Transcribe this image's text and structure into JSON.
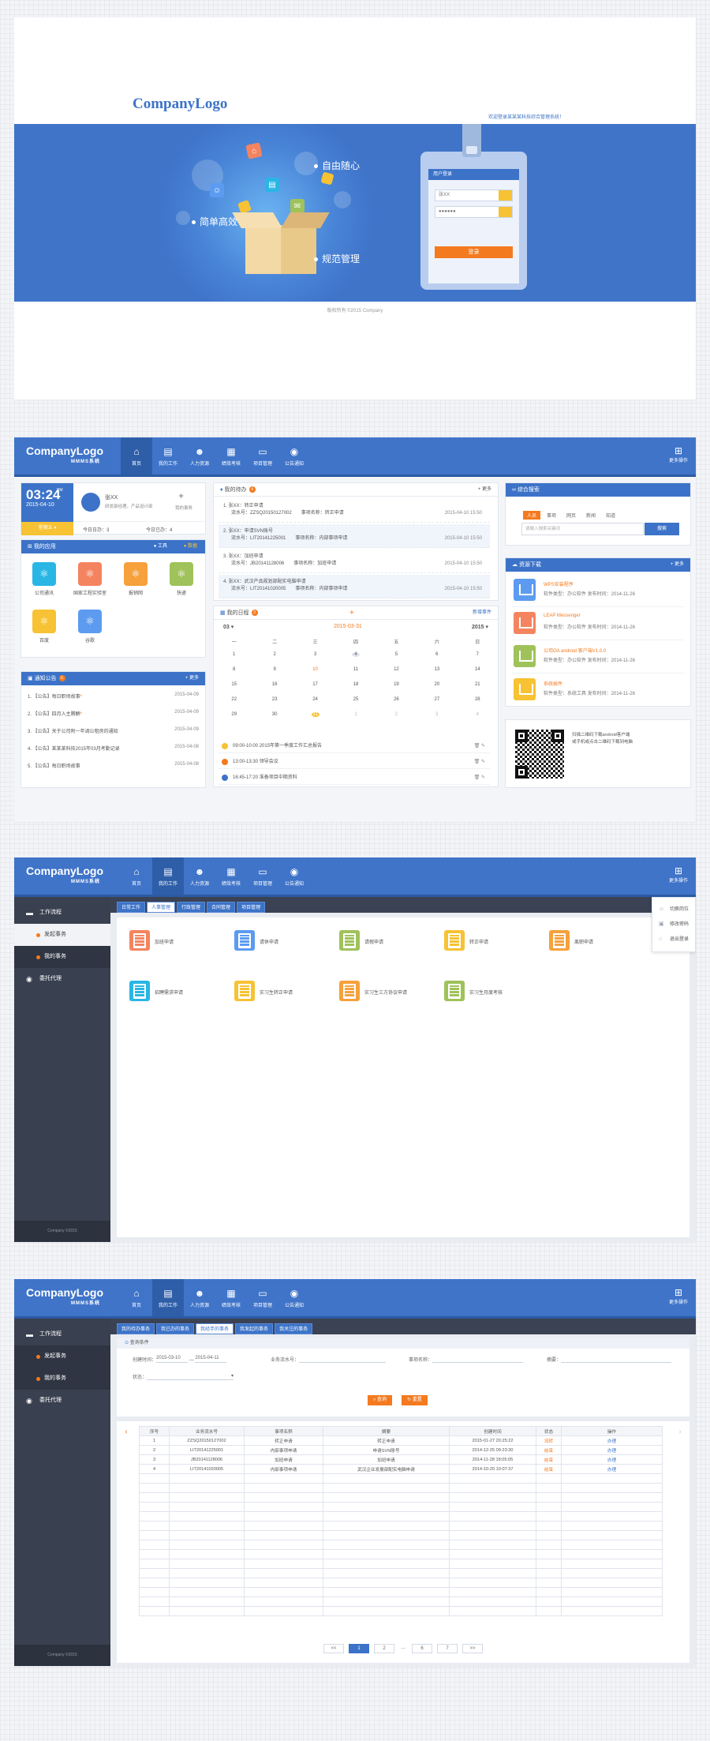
{
  "login": {
    "logo": "CompanyLogo",
    "welcome": "欢迎登录某某某科技综合管理系统！",
    "slogans": [
      "自由随心",
      "简单高效",
      "规范管理"
    ],
    "card_title": "用户登录",
    "username": "张XX",
    "password": "●●●●●●",
    "submit": "登录",
    "footer": "版权所有 ©2015 Company"
  },
  "header": {
    "logo": "CompanyLogo",
    "sublogo": "MMMS系统",
    "nav": [
      {
        "label": "首页",
        "icon": "home-icon",
        "glyph": "⌂"
      },
      {
        "label": "我的工作",
        "icon": "book-icon",
        "glyph": "▤"
      },
      {
        "label": "人力资源",
        "icon": "person-icon",
        "glyph": "☻"
      },
      {
        "label": "绩效考核",
        "icon": "calendar-icon",
        "glyph": "▦"
      },
      {
        "label": "项目管理",
        "icon": "monitor-icon",
        "glyph": "▭"
      },
      {
        "label": "公告通知",
        "icon": "chat-icon",
        "glyph": "◉"
      }
    ],
    "more": "更多操作"
  },
  "dashboard": {
    "time": "03:24",
    "ampm": "PM",
    "date": "2015-04-10",
    "weekday": "星期五",
    "user_name": "张XX",
    "user_role": "研发部经理，产品设计部",
    "user_msg": "我的事务",
    "today_todo": "今日日办：3",
    "today_done": "今日已办：4",
    "apps_title": "我的应用",
    "apps_tab1": "工具",
    "apps_tab2": "数据",
    "apps": [
      {
        "label": "公司通讯",
        "color": "#29b6e5"
      },
      {
        "label": "国家工程实验室",
        "color": "#f4845f"
      },
      {
        "label": "报销网",
        "color": "#f6a13c"
      },
      {
        "label": "快递",
        "color": "#9fc25a"
      },
      {
        "label": "百度",
        "color": "#f7c233"
      },
      {
        "label": "谷歌",
        "color": "#5c9bf0"
      }
    ],
    "notice_title": "通知公告",
    "notice_more": "+ 更多",
    "notices": [
      {
        "text": "1. 【公告】每日职场故事",
        "date": "2015-04-09"
      },
      {
        "text": "2. 【公告】四月入主腾酬",
        "date": "2015-04-09"
      },
      {
        "text": "3. 【公告】关于公司附一年调公租房的通知",
        "date": "2015-04-09"
      },
      {
        "text": "4. 【公告】某某某科技2015年03月考勤记录",
        "date": "2015-04-08"
      },
      {
        "text": "5. 【公告】每日职场故事",
        "date": "2015-04-08"
      }
    ],
    "todo_title": "我的待办",
    "todo_more": "+ 更多",
    "todos": [
      {
        "line1": "1. 张XX：转正申请",
        "line2": "流水号：ZZSQ20150127002",
        "line3": "事项名称：转正申请",
        "date": "2015-04-10  15:50"
      },
      {
        "line1": "2. 张XX：申请SVN账号",
        "line2": "流水号：LIT20141225001",
        "line3": "事项名称：内部事项申请",
        "date": "2015-04-10  15:50"
      },
      {
        "line1": "3. 张XX：加班申请",
        "line2": "流水号：JB20141128006",
        "line3": "事项名称：加班申请",
        "date": "2015-04-10  15:50"
      },
      {
        "line1": "4. 张XX：武汉产品规划部配实电脑申请",
        "line2": "流水号：LIT20141020005",
        "line3": "事项名称：内部事项申请",
        "date": "2015-04-10  15:50"
      }
    ],
    "cal_title": "我的日程",
    "cal_add": "+",
    "cal_new": "新增事件",
    "cal_month": "03",
    "cal_current": "2015-03-31",
    "cal_year": "2015",
    "weekdays": [
      "一",
      "二",
      "三",
      "四",
      "五",
      "六",
      "日"
    ],
    "days": [
      "1",
      "2",
      "3",
      "4",
      "5",
      "6",
      "7",
      "8",
      "9",
      "10",
      "11",
      "12",
      "13",
      "14",
      "15",
      "16",
      "17",
      "18",
      "19",
      "20",
      "21",
      "22",
      "23",
      "24",
      "25",
      "26",
      "27",
      "28",
      "29",
      "30",
      "31",
      "1",
      "2",
      "3",
      "4"
    ],
    "schedule": [
      {
        "text": "09:00-10:00  2015年第一季度工作汇总报告",
        "color": "#f7c233"
      },
      {
        "text": "13:00-13:30  领导会议",
        "color": "#f47a1f"
      },
      {
        "text": "16:45-17:20  准备项目中期资料",
        "color": "#3c73c8"
      }
    ],
    "search_title": "综合搜索",
    "search_tabs": [
      "人员",
      "事项",
      "网页",
      "新闻",
      "知道"
    ],
    "search_placeholder": "请输入搜索关键词",
    "search_btn": "搜索",
    "dl_title": "资源下载",
    "dl_more": "+ 更多",
    "downloads": [
      {
        "title": "WPS安装程序",
        "meta": "软件类型：办公软件    发布时间：2014-11-26",
        "color": "#5c9bf0"
      },
      {
        "title": "LEAP Messenger",
        "meta": "软件类型：办公软件    发布时间：2014-11-26",
        "color": "#f4845f"
      },
      {
        "title": "公司OA android 客户端V1.0.0",
        "meta": "软件类型：办公软件    发布时间：2014-11-26",
        "color": "#9fc25a"
      },
      {
        "title": "系统插件",
        "meta": "软件类型：系统工具    发布时间：2014-11-26",
        "color": "#f7c233"
      }
    ],
    "qr_line1": "扫描二维码下载android客户端",
    "qr_line2": "或手机或点击二维码下载到电脑"
  },
  "side": {
    "items": [
      "工作流程",
      "发起事务",
      "我的事务",
      "委托代理"
    ],
    "footer": "Company  ©2015"
  },
  "work": {
    "tabs": [
      "日常工作",
      "人事管理",
      "行政管理",
      "合同管理",
      "项目管理"
    ],
    "forms": [
      {
        "label": "加班申请",
        "color": "#f4845f"
      },
      {
        "label": "请休申请",
        "color": "#5c9bf0"
      },
      {
        "label": "请假申请",
        "color": "#9fc25a"
      },
      {
        "label": "转正申请",
        "color": "#f7c233"
      },
      {
        "label": "离职申请",
        "color": "#f6a13c"
      },
      {
        "label": "招聘需求申请",
        "color": "#29b6e5"
      },
      {
        "label": "实习生转正申请",
        "color": "#f7c233"
      },
      {
        "label": "实习生三方协议申请",
        "color": "#f6a13c"
      },
      {
        "label": "实习生月度考核",
        "color": "#9fc25a"
      }
    ],
    "dropdown": [
      "切换岗位",
      "修改密码",
      "退出登录"
    ]
  },
  "query": {
    "tabs": [
      "我的待办事务",
      "我已办的事务",
      "我经手的事务",
      "我发起的事务",
      "我关注的事务"
    ],
    "panel_title": "查询条件",
    "f_date_label": "创建时间：",
    "f_date_from": "2015-03-10",
    "f_date_to": "2015-04-11",
    "f_serial": "业务流水号：",
    "f_name": "事项名称：",
    "f_summary": "摘要：",
    "f_status": "状态：",
    "search_btn": "查询",
    "reset_btn": "重置",
    "columns": [
      "序号",
      "业务流水号",
      "事项名称",
      "摘要",
      "创建时间",
      "状态",
      "操作"
    ],
    "rows": [
      [
        "1",
        "ZZSQ20150127002",
        "转正申请",
        "转正申请",
        "2015-01-27 20:25:22",
        "流转",
        "办理"
      ],
      [
        "2",
        "LIT20141225001",
        "内部事项申请",
        "申请SVN账号",
        "2014-12-25 09:23:30",
        "结束",
        "办理"
      ],
      [
        "3",
        "JB20141128006",
        "加班申请",
        "加班申请",
        "2014-11-28 18:05:05",
        "结束",
        "办理"
      ],
      [
        "4",
        "LIT20141020005",
        "内部事项申请",
        "武汉企业发展部配实电脑申请",
        "2014-10-20 10:07:37",
        "结束",
        "办理"
      ]
    ],
    "pager": [
      "<<",
      "1",
      "2",
      "…",
      "6",
      "7",
      ">>"
    ]
  }
}
